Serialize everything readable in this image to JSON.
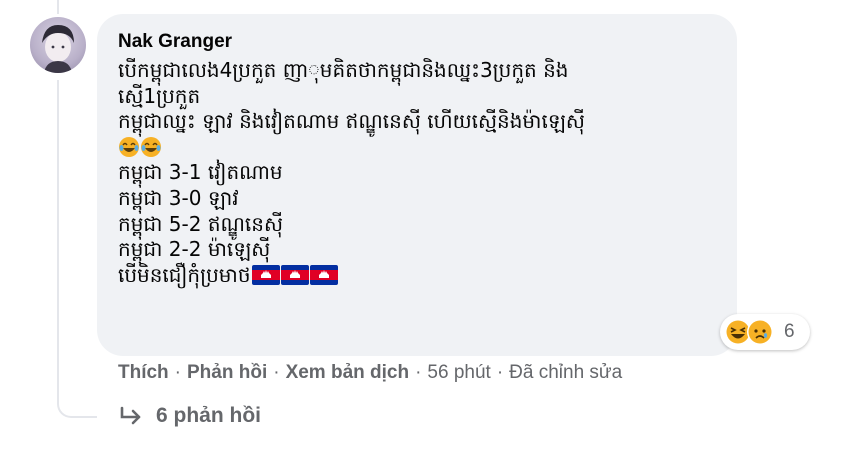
{
  "comment": {
    "author": "Nak Granger",
    "lines": [
      "បើកម្ពុជាលេង4ប្រកួត ញាុមគិតថាកម្ពុជានិងឈ្នះ3ប្រកួត និង",
      "ស្មើ1ប្រកួត",
      "កម្ពុជាឈ្នះ ឡាវ និងវៀតណាម ឥណ្ឌូនេស៊ី ហើយស្មើនិងម៉ាឡេស៊ី",
      "",
      "កម្ពុជា 3-1 វៀតណាម",
      "កម្ពុជា 3-0 ឡាវ",
      "កម្ពុជា 5-2 ឥណ្ឌូនេស៊ី",
      "កម្ពុជា 2-2 ម៉ាឡេស៊ី",
      "បើមិនជឿកុំប្រមាថ"
    ],
    "reactions": {
      "count": "6",
      "icons": [
        "haha-icon",
        "sad-icon"
      ]
    }
  },
  "actions": {
    "like": "Thích",
    "reply": "Phản hồi",
    "translate": "Xem bản dịch",
    "time": "56 phút",
    "edited": "Đã chỉnh sửa",
    "separator": "·"
  },
  "replies_label": "6 phản hồi",
  "colors": {
    "bubble": "#f0f2f5",
    "meta_text": "#65676b",
    "name_text": "#050505",
    "thread_line": "#e4e6eb",
    "haha": "#f7b125",
    "cambodia_blue": "#032ea1",
    "cambodia_red": "#e00025"
  }
}
